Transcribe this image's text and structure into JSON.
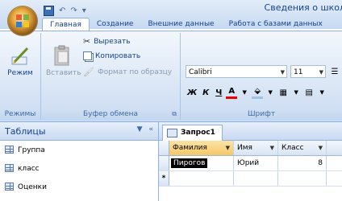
{
  "window": {
    "title": "Сведения о школ"
  },
  "quick_access": {
    "undo_glyph": "↶",
    "redo_glyph": "↷",
    "more_glyph": "▾"
  },
  "ribbon_tabs": [
    "Главная",
    "Создание",
    "Внешние данные",
    "Работа с базами данных"
  ],
  "ribbon": {
    "views": {
      "button_label": "Режим",
      "group_label": "Режимы"
    },
    "clipboard": {
      "paste_label": "Вставить",
      "cut_label": "Вырезать",
      "copy_label": "Копировать",
      "format_painter_label": "Формат по образцу",
      "group_label": "Буфер обмена"
    },
    "font": {
      "font_name": "Calibri",
      "font_size": "11",
      "bold": "Ж",
      "italic": "К",
      "underline": "Ч",
      "font_color_letter": "А",
      "group_label": "Шрифт"
    }
  },
  "nav_pane": {
    "title": "Таблицы",
    "items": [
      "Группа",
      "класс",
      "Оценки"
    ]
  },
  "document": {
    "tab_label": "Запрос1",
    "columns": [
      "Фамилия",
      "Имя",
      "Класс"
    ],
    "rows": [
      {
        "surname": "Пирогов",
        "name": "Юрий",
        "class": "8"
      }
    ],
    "new_row_marker": "*"
  },
  "colors": {
    "accent": "#15428b",
    "ribbon": "#dbe7f6",
    "border": "#8db2e3"
  }
}
